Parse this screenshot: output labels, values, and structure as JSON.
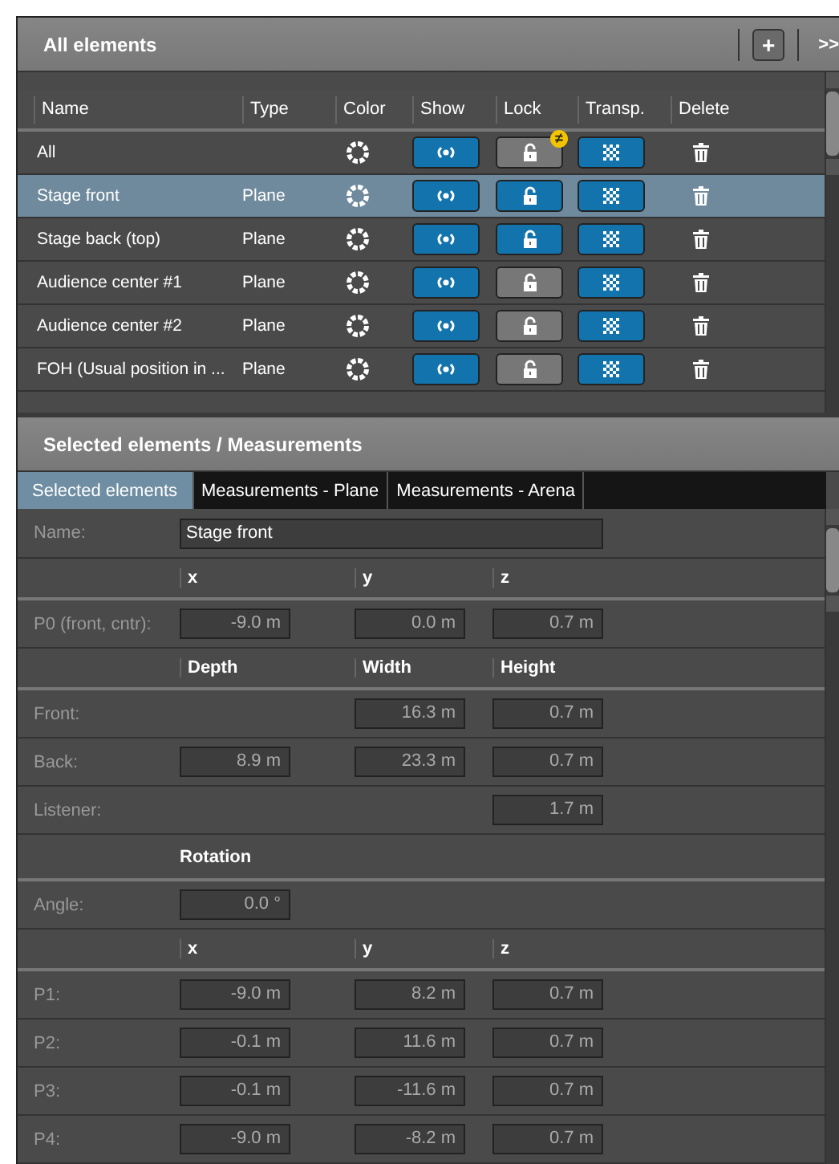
{
  "elements_panel": {
    "title": "All elements",
    "add_button": "+",
    "more_button": ">>",
    "columns": [
      "Name",
      "Type",
      "Color",
      "Show",
      "Lock",
      "Transp.",
      "Delete"
    ],
    "rows": [
      {
        "name": "All",
        "type": "",
        "selected": false,
        "show": true,
        "locked": false,
        "transparent": true,
        "badge": "≠"
      },
      {
        "name": "Stage front",
        "type": "Plane",
        "selected": true,
        "show": true,
        "locked": true,
        "transparent": true
      },
      {
        "name": "Stage back (top)",
        "type": "Plane",
        "selected": false,
        "show": true,
        "locked": true,
        "transparent": true
      },
      {
        "name": "Audience center #1",
        "type": "Plane",
        "selected": false,
        "show": true,
        "locked": false,
        "transparent": true
      },
      {
        "name": "Audience center #2",
        "type": "Plane",
        "selected": false,
        "show": true,
        "locked": false,
        "transparent": true
      },
      {
        "name": "FOH (Usual position in ...",
        "type": "Plane",
        "selected": false,
        "show": true,
        "locked": false,
        "transparent": true
      }
    ]
  },
  "selected_panel": {
    "title": "Selected elements / Measurements",
    "tabs": [
      {
        "label": "Selected elements",
        "selected": true
      },
      {
        "label": "Measurements - Plane",
        "selected": false
      },
      {
        "label": "Measurements - Arena",
        "selected": false
      }
    ],
    "rows": [
      {
        "kind": "name",
        "label": "Name:",
        "value": "Stage front"
      },
      {
        "kind": "header",
        "headings": [
          "x",
          "y",
          "z"
        ]
      },
      {
        "kind": "values",
        "label": "P0 (front, cntr):",
        "values": {
          "first": "-9.0 m",
          "second": "0.0 m",
          "third": "0.7 m"
        }
      },
      {
        "kind": "header",
        "headings": [
          "Depth",
          "Width",
          "Height"
        ]
      },
      {
        "kind": "values",
        "label": "Front:",
        "values": {
          "second": "16.3 m",
          "third": "0.7 m"
        }
      },
      {
        "kind": "values",
        "label": "Back:",
        "values": {
          "first": "8.9 m",
          "second": "23.3 m",
          "third": "0.7 m"
        }
      },
      {
        "kind": "values",
        "label": "Listener:",
        "values": {
          "third": "1.7 m"
        }
      },
      {
        "kind": "title",
        "heading": "Rotation"
      },
      {
        "kind": "values",
        "label": "Angle:",
        "values": {
          "first": "0.0 °"
        }
      },
      {
        "kind": "header",
        "headings": [
          "x",
          "y",
          "z"
        ]
      },
      {
        "kind": "values",
        "label": "P1:",
        "values": {
          "first": "-9.0 m",
          "second": "8.2 m",
          "third": "0.7 m"
        }
      },
      {
        "kind": "values",
        "label": "P2:",
        "values": {
          "first": "-0.1 m",
          "second": "11.6 m",
          "third": "0.7 m"
        }
      },
      {
        "kind": "values",
        "label": "P3:",
        "values": {
          "first": "-0.1 m",
          "second": "-11.6 m",
          "third": "0.7 m"
        }
      },
      {
        "kind": "values",
        "label": "P4:",
        "values": {
          "first": "-9.0 m",
          "second": "-8.2 m",
          "third": "0.7 m"
        }
      }
    ]
  }
}
